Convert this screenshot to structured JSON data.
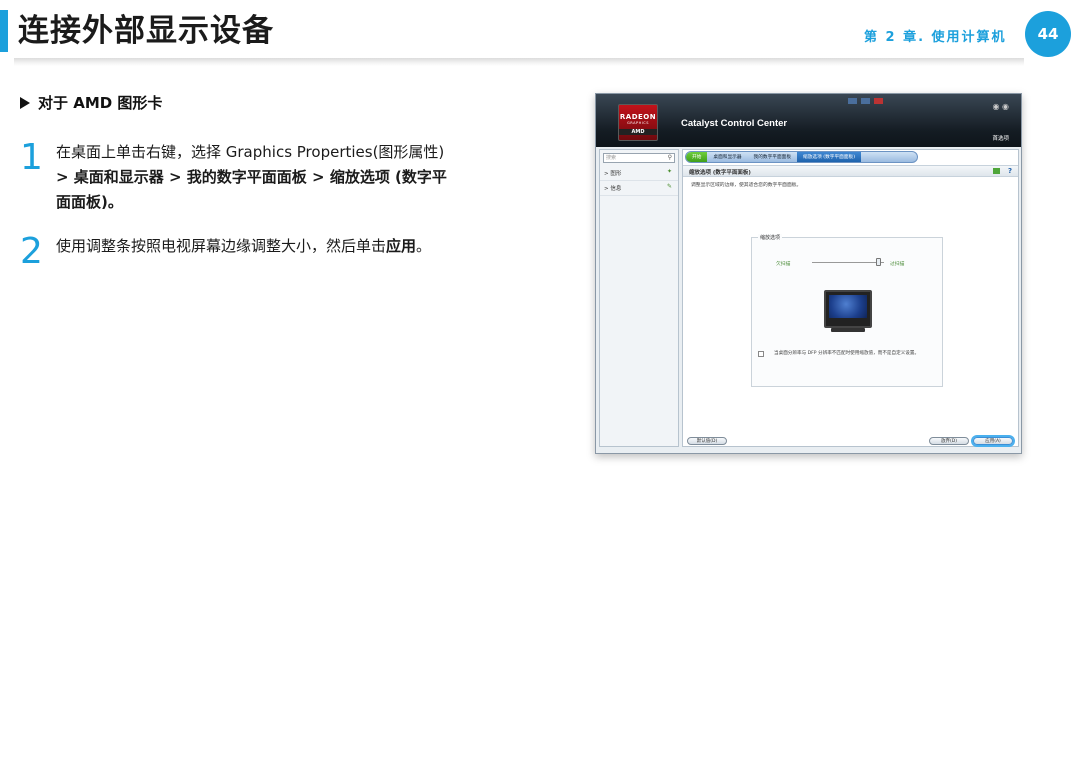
{
  "header": {
    "title": "连接外部显示设备",
    "chapter": "第 2 章. 使用计算机",
    "page_number": "44"
  },
  "section": {
    "title": "对于 AMD 图形卡"
  },
  "steps": [
    {
      "number": "1",
      "line1": "在桌面上单击右键，选择 Graphics Properties(图形属性)",
      "line2": "> 桌面和显示器 > 我的数字平面面板 > 缩放选项 (数字平",
      "line3": "面面板)。"
    },
    {
      "number": "2",
      "text_before": "使用调整条按照电视屏幕边缘调整大小，然后单击",
      "text_bold": "应用",
      "text_after": "。"
    }
  ],
  "screenshot": {
    "app_title": "Catalyst Control Center",
    "logo_line1": "RADEON",
    "logo_line2": "GRAPHICS",
    "logo_line3": "AMD",
    "preferences": "首选项",
    "search_placeholder": "搜索",
    "left_items": [
      "> 图形",
      "> 信息"
    ],
    "breadcrumbs": [
      "开始",
      "桌面和显示器",
      "我的数字平面面板",
      "缩放选项 (数字平面面板)"
    ],
    "panel_title": "缩放选项 (数字平面面板)",
    "panel_desc": "调整显示区域的边缘，使其适合您的数字平面面板。",
    "group_label": "缩放选项",
    "slider_left": "欠扫描",
    "slider_right": "过扫描",
    "slider_value": 0.92,
    "checkbox_text": "当桌面分辨率与 DFP 分辨率不匹配时使用缩放值，而不是自定义设置。",
    "defaults_button": "默认值(D)",
    "discard_button": "放弃(D)",
    "apply_button": "应用(A)",
    "accent_color": "#1ca0dc"
  }
}
